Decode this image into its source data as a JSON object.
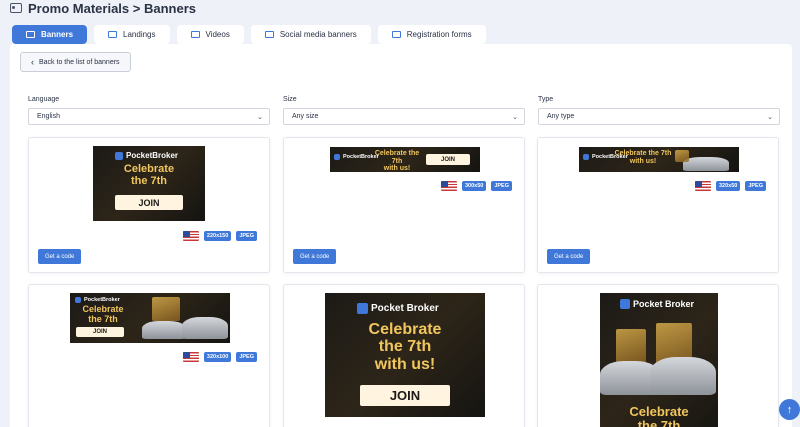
{
  "header": {
    "title": "Promo Materials > Banners",
    "icon": "image-icon"
  },
  "tabs": [
    {
      "label": "Banners",
      "icon": "image-icon",
      "active": true
    },
    {
      "label": "Landings",
      "icon": "browser-icon"
    },
    {
      "label": "Videos",
      "icon": "video-icon"
    },
    {
      "label": "Social media banners",
      "icon": "social-icon"
    },
    {
      "label": "Registration forms",
      "icon": "form-icon"
    }
  ],
  "back_label": "Back to the list of banners",
  "filters": {
    "language": {
      "label": "Language",
      "value": "English"
    },
    "size": {
      "label": "Size",
      "value": "Any size"
    },
    "type": {
      "label": "Type",
      "value": "Any type"
    }
  },
  "banner_text": {
    "brand": "Pocket Broker",
    "brand_short": "PocketBroker",
    "headline": "Celebrate the 7th with us!",
    "line1": "Celebrate",
    "line2": "the 7th",
    "line3": "with us!",
    "line_a": "Celebrate the 7th",
    "line_b": "with us!",
    "join": "JOIN"
  },
  "cards": [
    {
      "size": "220x150",
      "format": "JPEG",
      "button": "Get a code"
    },
    {
      "size": "300x50",
      "format": "JPEG",
      "button": "Get a code"
    },
    {
      "size": "320x50",
      "format": "JPEG",
      "button": "Get a code"
    },
    {
      "size": "320x100",
      "format": "JPEG"
    },
    {},
    {}
  ],
  "colors": {
    "accent": "#3f78d8",
    "gold": "#f1c65e",
    "dark": "#1c1a17"
  },
  "scroll_top_icon": "arrow-up-icon"
}
